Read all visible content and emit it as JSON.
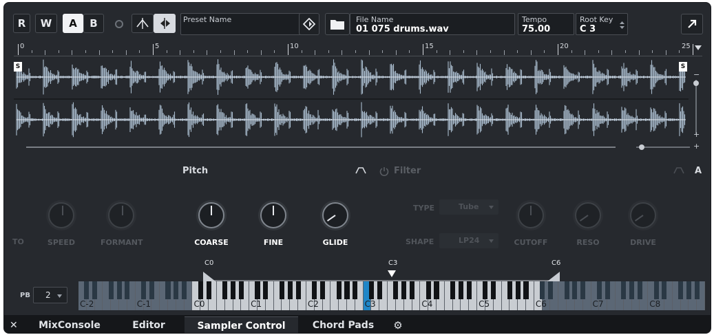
{
  "toolbar": {
    "r_label": "R",
    "w_label": "W",
    "a_label": "A",
    "b_label": "B",
    "preset_label": "Preset Name",
    "preset_value": "",
    "file_label": "File Name",
    "file_value": "01 075 drums.wav",
    "tempo_label": "Tempo",
    "tempo_value": "75.00",
    "rootkey_label": "Root Key",
    "rootkey_value": "C 3"
  },
  "ruler": {
    "labels": [
      "0",
      "5",
      "10",
      "15",
      "20",
      "25"
    ]
  },
  "sample": {
    "start_marker": "S",
    "end_marker": "S"
  },
  "sections": {
    "pitch": "Pitch",
    "filter": "Filter",
    "amp_partial": "A"
  },
  "pitch_knobs": {
    "to_partial": "TO",
    "speed": "SPEED",
    "formant": "FORMANT",
    "coarse": "COARSE",
    "fine": "FINE",
    "glide": "GLIDE"
  },
  "filter_controls": {
    "type_label": "TYPE",
    "type_value": "Tube",
    "shape_label": "SHAPE",
    "shape_value": "LP24",
    "cutoff": "CUTOFF",
    "reso": "RESO",
    "drive": "DRIVE"
  },
  "keyrange": {
    "low": "C0",
    "root": "C3",
    "high": "C6"
  },
  "keyboard": {
    "pb_label": "PB",
    "pb_value": "2",
    "octaves": [
      "C-2",
      "C-1",
      "C0",
      "C1",
      "C2",
      "C3",
      "C4",
      "C5",
      "C6",
      "C7",
      "C8"
    ]
  },
  "bottom_tabs": {
    "mixconsole": "MixConsole",
    "editor": "Editor",
    "sampler": "Sampler Control",
    "chordpads": "Chord Pads"
  },
  "colors": {
    "background": "#26292e",
    "waveform": "#a9bccd",
    "accent": "#1f86c7"
  }
}
